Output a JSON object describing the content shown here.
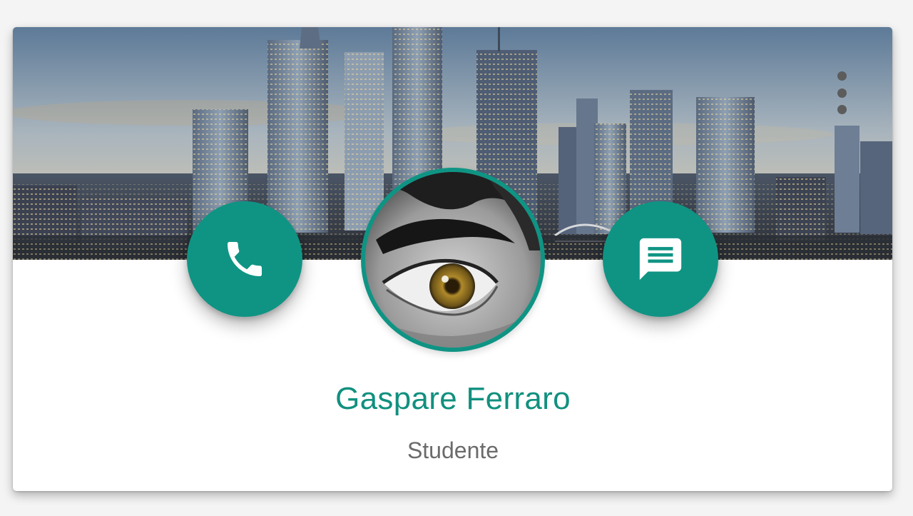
{
  "profile": {
    "name": "Gaspare Ferraro",
    "role": "Studente"
  },
  "icons": {
    "menu": "more-vert-icon",
    "call": "phone-icon",
    "message": "message-icon"
  },
  "colors": {
    "accent": "#0f9484",
    "name_text": "#11907f",
    "role_text": "#6b6b6b"
  }
}
